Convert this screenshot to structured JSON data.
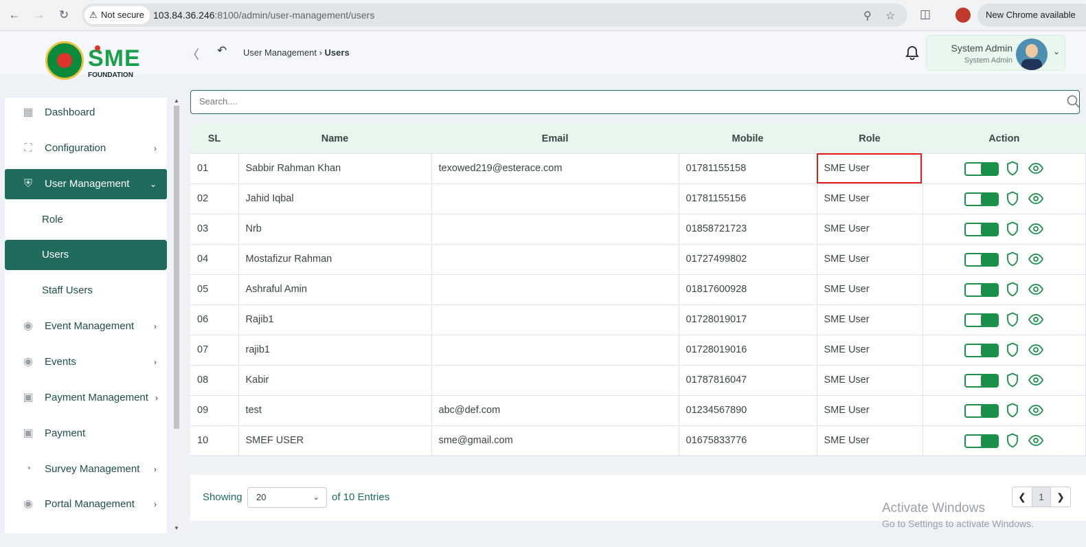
{
  "browser": {
    "security_label": "Not secure",
    "url_host": "103.84.36.246",
    "url_rest": ":8100/admin/user-management/users",
    "new_chrome": "New Chrome available"
  },
  "brand": {
    "logo_text": "SME",
    "logo_sub": "FOUNDATION"
  },
  "breadcrumb": {
    "parent": "User Management",
    "current": "Users"
  },
  "user": {
    "name": "System Admin",
    "role": "System Admin"
  },
  "sidebar": {
    "items": [
      {
        "label": "Dashboard",
        "icon": "dashboard-icon"
      },
      {
        "label": "Configuration",
        "icon": "configuration-icon"
      },
      {
        "label": "User Management",
        "icon": "shield-user-icon"
      },
      {
        "label": "Role"
      },
      {
        "label": "Users"
      },
      {
        "label": "Staff Users"
      },
      {
        "label": "Event Management",
        "icon": "lock-circle-icon"
      },
      {
        "label": "Events",
        "icon": "lock-circle-icon"
      },
      {
        "label": "Payment Management",
        "icon": "payment-icon"
      },
      {
        "label": "Payment",
        "icon": "payment-icon"
      },
      {
        "label": "Survey Management",
        "icon": "pie-icon"
      },
      {
        "label": "Portal Management",
        "icon": "lock-circle-icon"
      }
    ]
  },
  "search": {
    "placeholder": "Search...."
  },
  "table": {
    "headers": [
      "SL",
      "Name",
      "Email",
      "Mobile",
      "Role",
      "Action"
    ],
    "rows": [
      {
        "sl": "01",
        "name": "Sabbir Rahman Khan",
        "email": "texowed219@esterace.com",
        "mobile": "01781155158",
        "role": "SME User"
      },
      {
        "sl": "02",
        "name": "Jahid Iqbal",
        "email": "",
        "mobile": "01781155156",
        "role": "SME User"
      },
      {
        "sl": "03",
        "name": "Nrb",
        "email": "",
        "mobile": "01858721723",
        "role": "SME User"
      },
      {
        "sl": "04",
        "name": "Mostafizur Rahman",
        "email": "",
        "mobile": "01727499802",
        "role": "SME User"
      },
      {
        "sl": "05",
        "name": "Ashraful Amin",
        "email": "",
        "mobile": "01817600928",
        "role": "SME User"
      },
      {
        "sl": "06",
        "name": "Rajib1",
        "email": "",
        "mobile": "01728019017",
        "role": "SME User"
      },
      {
        "sl": "07",
        "name": "rajib1",
        "email": "",
        "mobile": "01728019016",
        "role": "SME User"
      },
      {
        "sl": "08",
        "name": "Kabir",
        "email": "",
        "mobile": "01787816047",
        "role": "SME User"
      },
      {
        "sl": "09",
        "name": "test",
        "email": "abc@def.com",
        "mobile": "01234567890",
        "role": "SME User"
      },
      {
        "sl": "10",
        "name": "SMEF USER",
        "email": "sme@gmail.com",
        "mobile": "01675833776",
        "role": "SME User"
      }
    ]
  },
  "footer": {
    "showing": "Showing",
    "page_size": "20",
    "entries": "of 10 Entries",
    "current_page": "1"
  },
  "watermark": {
    "title": "Activate Windows",
    "sub": "Go to Settings to activate Windows."
  },
  "colors": {
    "primary": "#1f6b5e",
    "accent": "#1a8f4a",
    "highlight": "#e31b1b"
  }
}
